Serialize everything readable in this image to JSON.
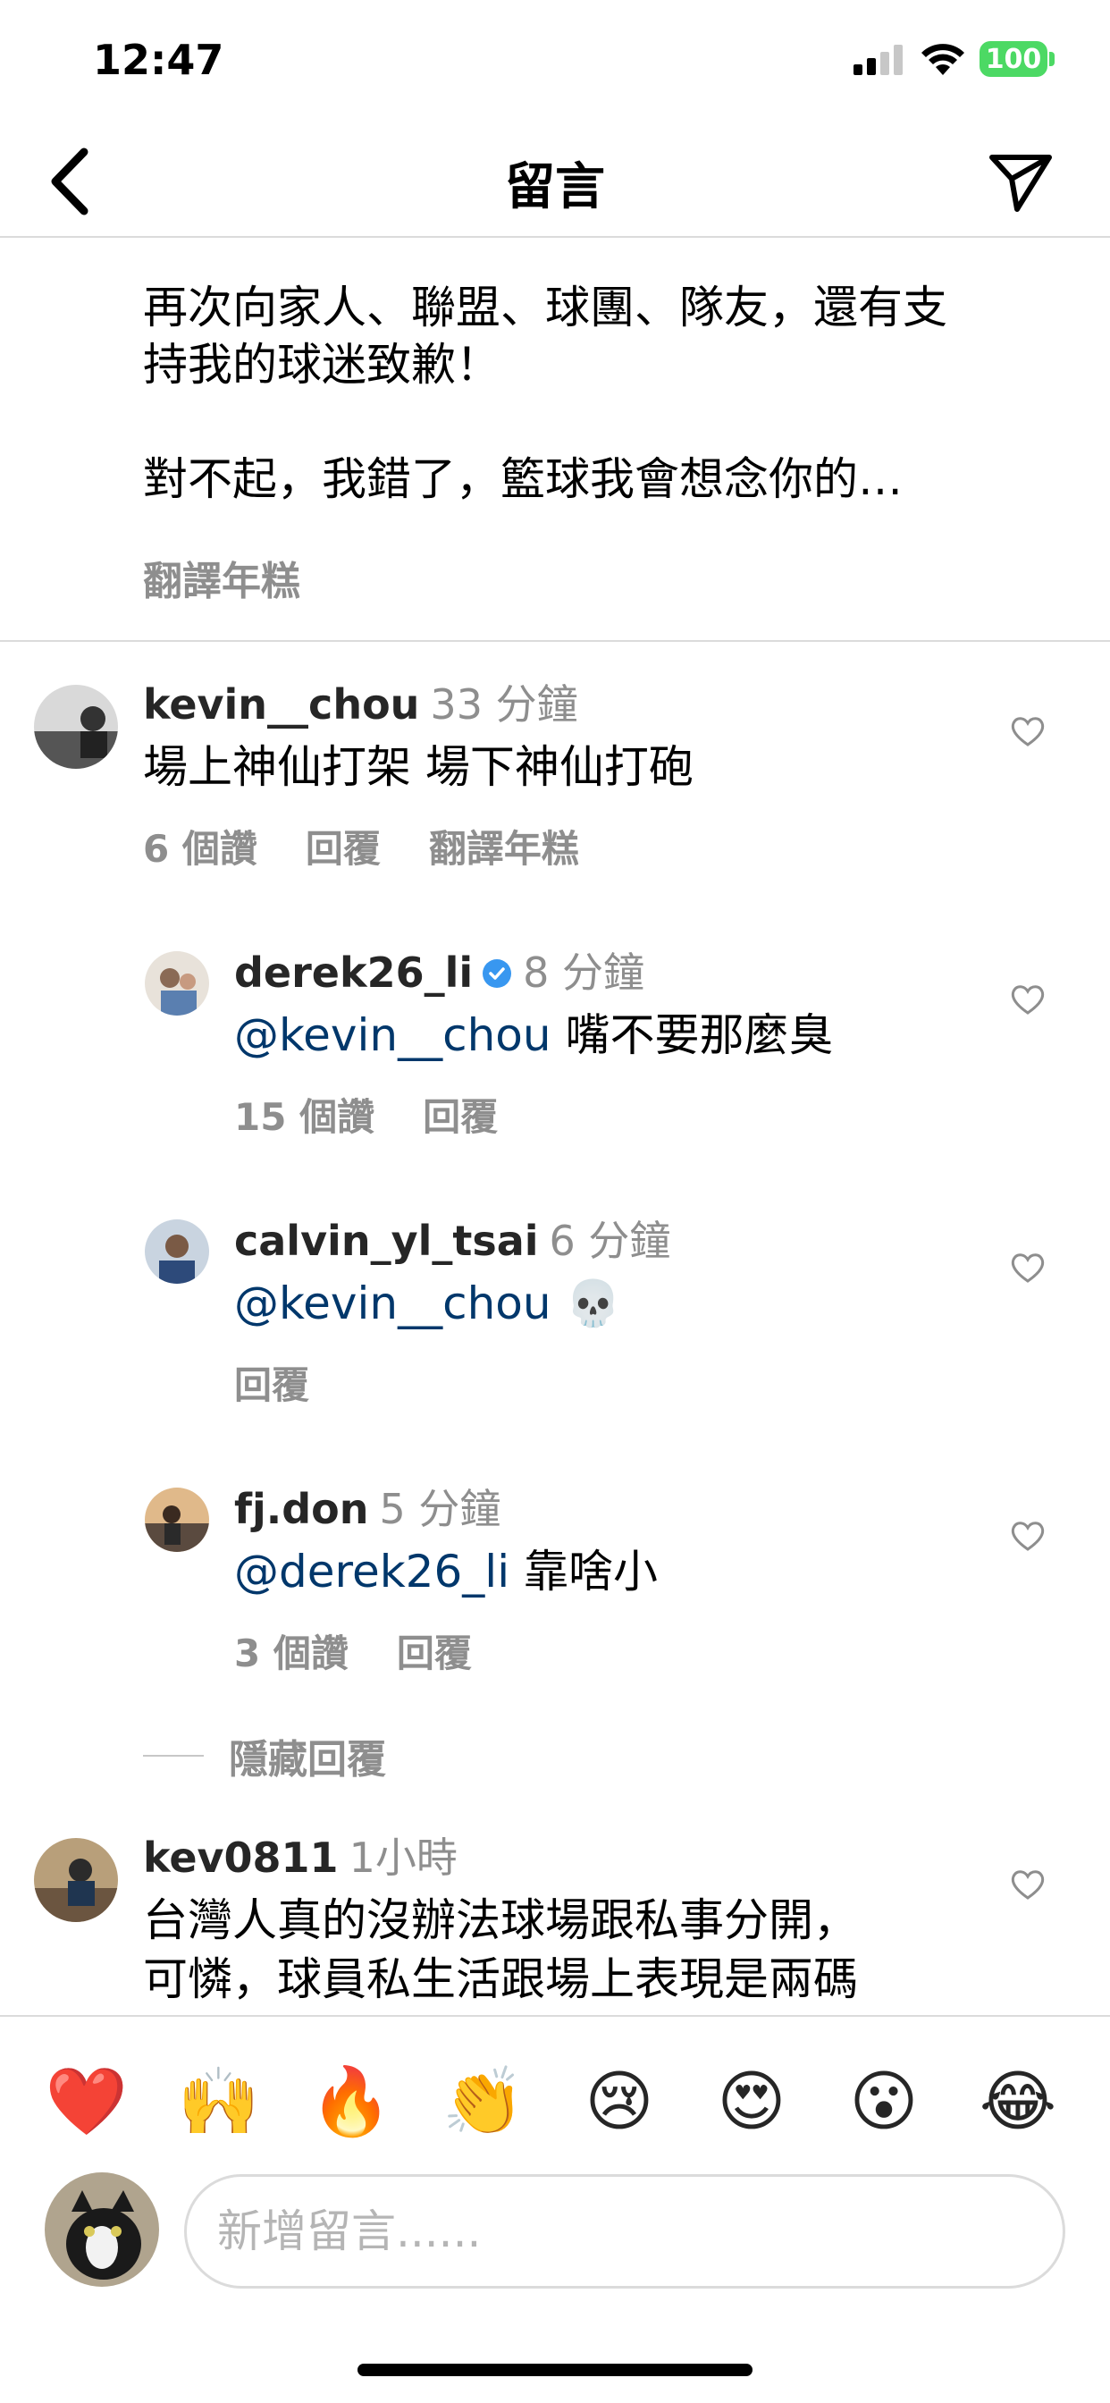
{
  "status_bar": {
    "time": "12:47",
    "battery": "100"
  },
  "header": {
    "title": "留言"
  },
  "caption": {
    "lines": [
      "再次向家人、聯盟、球團、隊友，還有支",
      "持我的球迷致歉！",
      "",
      "對不起，我錯了，籃球我會想念你的…"
    ],
    "translate_label": "翻譯年糕"
  },
  "comments": [
    {
      "username": "kevin__chou",
      "time": "33 分鐘",
      "mention": "",
      "text": "場上神仙打架 場下神仙打砲",
      "likes": "6 個讚",
      "reply_label": "回覆",
      "translate_label": "翻譯年糕"
    }
  ],
  "replies": [
    {
      "username": "derek26_li",
      "verified": true,
      "time": "8 分鐘",
      "mention": "@kevin__chou",
      "text": " 嘴不要那麼臭",
      "likes": "15 個讚",
      "reply_label": "回覆"
    },
    {
      "username": "calvin_yl_tsai",
      "verified": false,
      "time": "6 分鐘",
      "mention": "@kevin__chou",
      "text": " 💀",
      "likes": "",
      "reply_label": "回覆"
    },
    {
      "username": "fj.don",
      "verified": false,
      "time": "5 分鐘",
      "mention": "@derek26_li",
      "text": " 靠啥小",
      "likes": "3 個讚",
      "reply_label": "回覆"
    }
  ],
  "hide_replies_label": "隱藏回覆",
  "last_comment": {
    "username": "kev0811",
    "time": "1小時",
    "lines": [
      "台灣人真的沒辦法球場跟私事分開，",
      "可憐，球員私生活跟場上表現是兩碼"
    ]
  },
  "emoji_bar": [
    "❤️",
    "🙌",
    "🔥",
    "👏",
    "😢",
    "😍",
    "😮",
    "😂"
  ],
  "input": {
    "placeholder": "新增留言......"
  },
  "icons": {
    "back": "chevron-left-icon",
    "send": "paper-plane-icon",
    "heart": "heart-outline-icon",
    "verified": "verified-badge-icon",
    "signal": "cellular-signal-icon",
    "wifi": "wifi-icon"
  },
  "colors": {
    "mention": "#00376b",
    "muted": "#8e8e8e",
    "verified": "#3897f0",
    "battery": "#4cd964"
  }
}
